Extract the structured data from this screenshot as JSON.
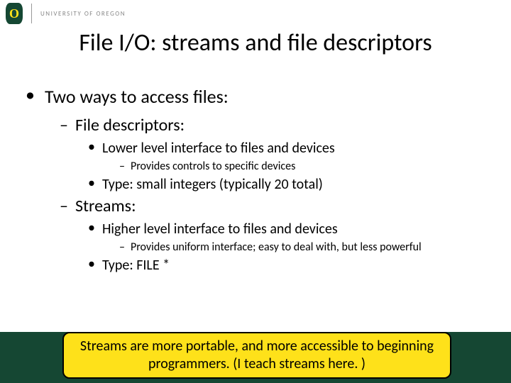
{
  "brand": {
    "logo_letter": "O",
    "university": "UNIVERSITY OF OREGON",
    "colors": {
      "green": "#154733",
      "yellow": "#FEE11A"
    }
  },
  "title": "File I/O: streams and file descriptors",
  "body": {
    "intro": "Two ways to access files:",
    "fd": {
      "heading": "File descriptors:",
      "p1": "Lower level interface to files and devices",
      "p1a": "Provides controls to specific devices",
      "p2": "Type: small integers (typically 20 total)"
    },
    "streams": {
      "heading": "Streams:",
      "p1": "Higher level interface to files and devices",
      "p1a": "Provides uniform interface; easy to deal with, but less powerful",
      "p2": "Type: FILE *"
    }
  },
  "callout": "Streams are more portable, and more accessible to beginning programmers.  (I teach streams here. )"
}
